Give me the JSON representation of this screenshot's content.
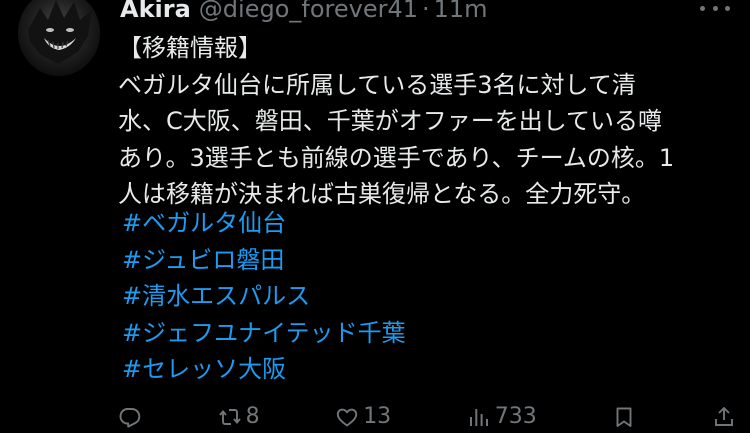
{
  "tweet": {
    "author": {
      "display_name": "Akira",
      "handle": "@diego_forever41",
      "separator": "·",
      "time": "11m"
    },
    "body_lines": [
      "【移籍情報】",
      "ベガルタ仙台に所属している選手3名に対して清",
      "水、C大阪、磐田、千葉がオファーを出している噂",
      "あり。3選手とも前線の選手であり、チームの核。1",
      "人は移籍が決まれば古巣復帰となる。全力死守。"
    ],
    "hashtags": [
      "#ベガルタ仙台",
      "#ジュビロ磐田",
      "#清水エスパルス",
      "#ジェフユナイテッド千葉",
      "#セレッソ大阪"
    ],
    "actions": {
      "reply_icon": "reply-icon",
      "retweet_icon": "retweet-icon",
      "retweet_count": "8",
      "like_icon": "like-icon",
      "like_count": "13",
      "views_icon": "views-icon",
      "views_count": "733",
      "bookmark_icon": "bookmark-icon",
      "share_icon": "share-icon"
    },
    "colors": {
      "background": "#000000",
      "text": "#e7e9ea",
      "secondary": "#71767b",
      "link": "#1d9bf0"
    }
  }
}
